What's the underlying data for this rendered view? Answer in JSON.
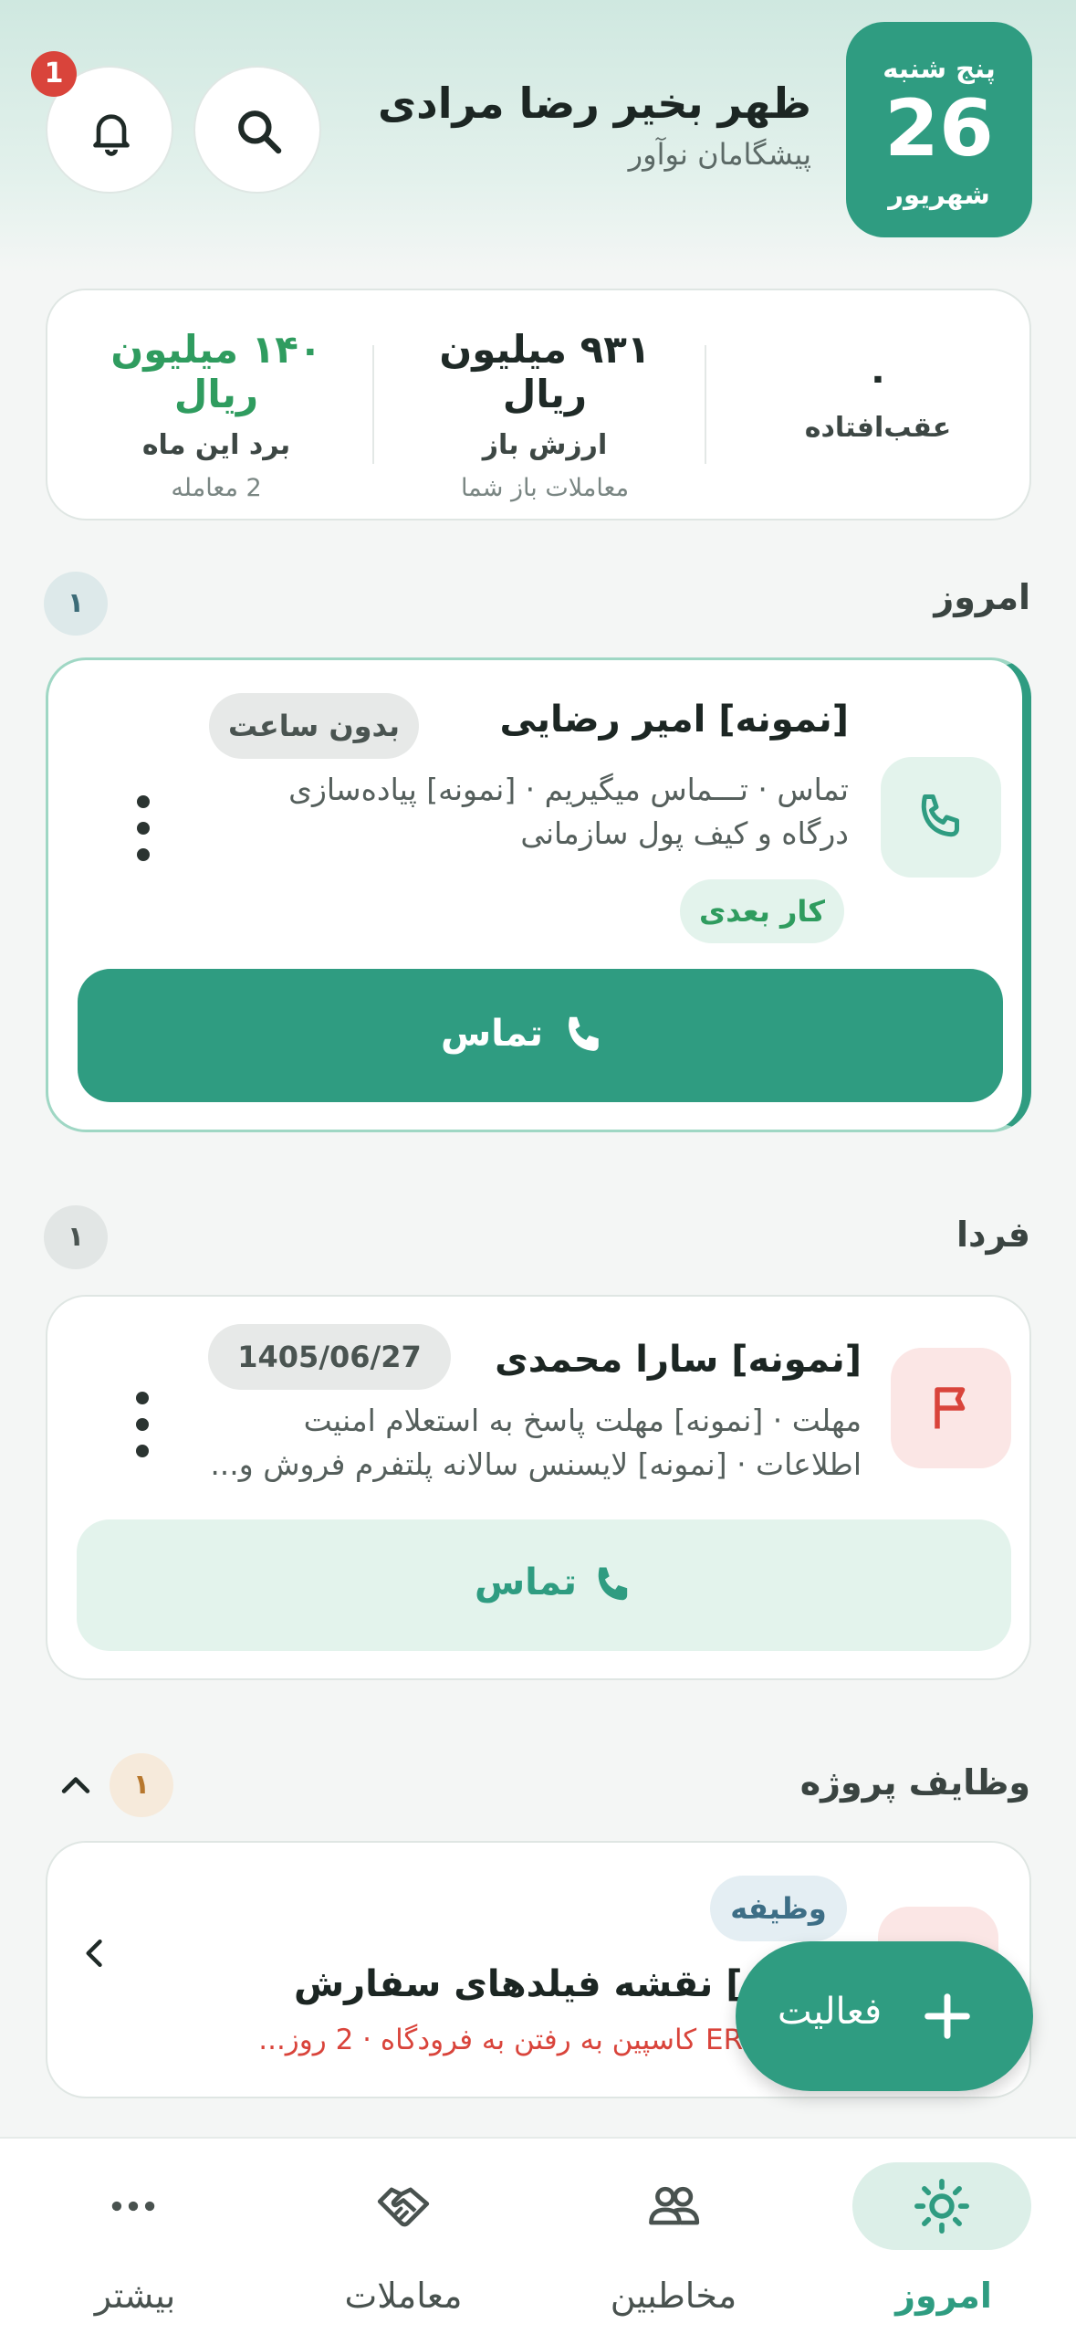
{
  "header": {
    "date": {
      "day_of_week": "پنج شنبه",
      "day": "26",
      "month": "شهریور"
    },
    "greeting": "ظهر بخیر رضا مرادی",
    "company": "پیشگامان نوآور",
    "notifications_count": "1"
  },
  "stats": {
    "overdue": {
      "value": "۰",
      "label": "عقب‌افتاده"
    },
    "open_value": {
      "value": "۹۳۱ میلیون ریال",
      "label": "ارزش باز",
      "sub": "معاملات باز شما"
    },
    "won": {
      "value": "۱۴۰ میلیون ریال",
      "label": "برد این ماه",
      "sub": "2 معامله"
    }
  },
  "sections": {
    "today": {
      "title": "امروز",
      "count": "۱",
      "item": {
        "title": "[نمونه] امیر رضایی",
        "time_chip": "بدون ساعت",
        "desc_line1": "تماس · تـــماس میگیریم · [نمونه] پیاده‌سازی",
        "desc_line2": "درگاه و کیف پول سازمانی",
        "next_chip": "کار بعدی",
        "call_label": "تماس"
      }
    },
    "tomorrow": {
      "title": "فردا",
      "count": "۱",
      "item": {
        "title": "[نمونه] سارا محمدی",
        "date_chip": "1405/06/27",
        "desc_line1": "مهلت · [نمونه] مهلت پاسخ به استعلام امنیت",
        "desc_line2": "اطلاعات · [نمونه] لایسنس سالانه پلتفرم فروش و...",
        "call_label": "تماس"
      }
    },
    "project_tasks": {
      "title": "وظایف پروژه",
      "count": "۱",
      "item": {
        "tag": "وظیفه",
        "title": "[نمونه] نقشه فیلدهای سفارش",
        "desc": "یکپارچه ERP کاسپین به رفتن به فرودگاه · 2 روز..."
      }
    }
  },
  "fab": {
    "label": "فعالیت"
  },
  "bottom_nav": {
    "today": "امروز",
    "contacts": "مخاطبین",
    "deals": "معاملات",
    "more": "بیشتر"
  },
  "colors": {
    "primary": "#2f9c81",
    "won_green": "#2f9c5f",
    "alert_red": "#d9443b",
    "tile_green": "#e3f3ec",
    "tile_red": "#fbe6e5"
  }
}
